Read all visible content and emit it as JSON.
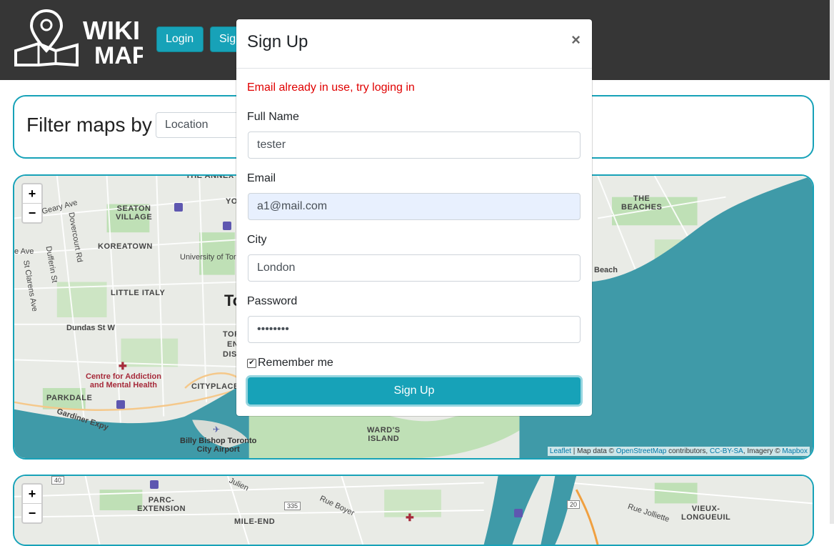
{
  "header": {
    "logo": {
      "line1": "WIKI",
      "line2": "MAP"
    },
    "login_label": "Login",
    "signup_label": "Sig"
  },
  "filter": {
    "label": "Filter maps by",
    "select_value": "Location"
  },
  "map1": {
    "zoom_in": "+",
    "zoom_out": "−",
    "labels": {
      "the_annex": "THE ANNEX",
      "york": "YORK",
      "seaton_village": "SEATON\nVILLAGE",
      "koreatown": "KOREATOWN",
      "university": "University of Tor",
      "little_italy": "LITTLE ITALY",
      "dundas": "Dundas St W",
      "parkdale": "PARKDALE",
      "cityplace": "CITYPLACE",
      "gardiner": "Gardiner Expy",
      "camh": "Centre for Addiction\nand Mental Health",
      "billy_bishop": "Billy Bishop Toronto\nCity Airport",
      "wards_island": "WARD'S\nISLAND",
      "the_beaches": "THE\nBEACHES",
      "beach": "Beach",
      "toronto_fragment": "To",
      "geary": "Geary Ave",
      "dovercourt": "Dovercourt Rd",
      "dufferin": "Dufferin St",
      "st_clarens": "St Clarens Ave",
      "ave": "e Ave",
      "toro": "TORO",
      "enter": "ENTER",
      "dis": "DIS"
    },
    "attribution": {
      "leaflet": "Leaflet",
      "map_data": " | Map data © ",
      "osm": "OpenStreetMap",
      "contributors": " contributors, ",
      "license": "CC-BY-SA",
      "imagery": ", Imagery © ",
      "mapbox": "Mapbox"
    }
  },
  "map2": {
    "zoom_in": "+",
    "zoom_out": "−",
    "labels": {
      "parc_extension": "PARC-\nEXTENSION",
      "mile_end": "MILE-END",
      "vieux_longueuil": "VIEUX-\nLONGUEUIL",
      "rue_boyer": "Rue Boyer",
      "rue_jolliette": "Rue Jolliette",
      "julien": "Julien",
      "route_335": "335",
      "route_20": "20",
      "route_40": "40"
    }
  },
  "modal": {
    "title": "Sign Up",
    "close": "×",
    "error": "Email already in use, try loging in",
    "fields": {
      "full_name_label": "Full Name",
      "full_name_value": "tester",
      "email_label": "Email",
      "email_value": "a1@mail.com",
      "city_label": "City",
      "city_value": "London",
      "password_label": "Password",
      "password_value": "••••••••"
    },
    "remember_label": "Remember me",
    "remember_checked": true,
    "submit_label": "Sign Up"
  },
  "colors": {
    "header_bg": "#363636",
    "accent": "#17a2b8",
    "error": "#e00000",
    "water": "#3f9aa8"
  }
}
